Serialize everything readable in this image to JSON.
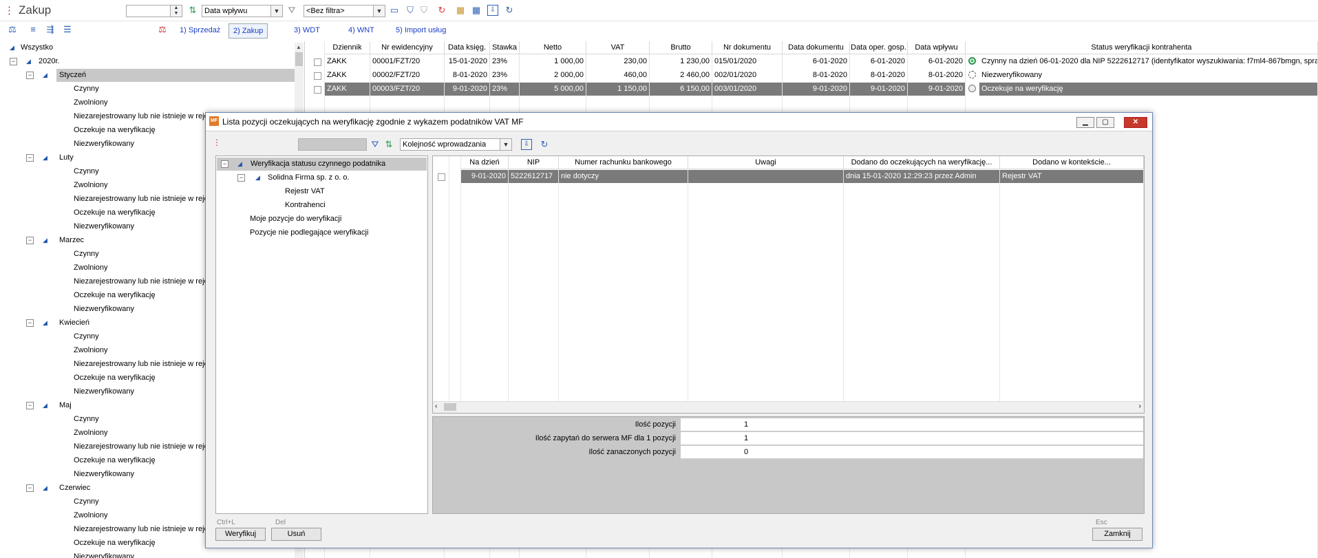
{
  "app": {
    "title": "Zakup"
  },
  "toolbar": {
    "sort_field": "Data wpływu",
    "filter": "<Bez filtra>"
  },
  "tabs": [
    {
      "label": "1) Sprzedaż"
    },
    {
      "label": "2) Zakup"
    },
    {
      "label": "3) WDT"
    },
    {
      "label": "4) WNT"
    },
    {
      "label": "5) Import usług"
    }
  ],
  "tree": {
    "root": "Wszystko",
    "year": "2020r.",
    "months": [
      {
        "name": "Styczeń",
        "children": [
          "Czynny",
          "Zwolniony",
          "Niezarejestrowany lub nie istnieje w rejes",
          "Oczekuje na weryfikację",
          "Niezweryfikowany"
        ]
      },
      {
        "name": "Luty",
        "children": [
          "Czynny",
          "Zwolniony",
          "Niezarejestrowany lub nie istnieje w rejes",
          "Oczekuje na weryfikację",
          "Niezweryfikowany"
        ]
      },
      {
        "name": "Marzec",
        "children": [
          "Czynny",
          "Zwolniony",
          "Niezarejestrowany lub nie istnieje w rejes",
          "Oczekuje na weryfikację",
          "Niezweryfikowany"
        ]
      },
      {
        "name": "Kwiecień",
        "children": [
          "Czynny",
          "Zwolniony",
          "Niezarejestrowany lub nie istnieje w rejes",
          "Oczekuje na weryfikację",
          "Niezweryfikowany"
        ]
      },
      {
        "name": "Maj",
        "children": [
          "Czynny",
          "Zwolniony",
          "Niezarejestrowany lub nie istnieje w rejes",
          "Oczekuje na weryfikację",
          "Niezweryfikowany"
        ]
      },
      {
        "name": "Czerwiec",
        "children": [
          "Czynny",
          "Zwolniony",
          "Niezarejestrowany lub nie istnieje w rejes",
          "Oczekuje na weryfikację",
          "Niezweryfikowany"
        ]
      }
    ]
  },
  "grid": {
    "headers": [
      "Dziennik",
      "Nr ewidencyjny",
      "Data księg.",
      "Stawka",
      "Netto",
      "VAT",
      "Brutto",
      "Nr dokumentu",
      "Data dokumentu",
      "Data oper. gosp.",
      "Data wpływu",
      "Status weryfikacji kontrahenta"
    ],
    "rows": [
      {
        "dziennik": "ZAKK",
        "nr": "00001/FZT/20",
        "data_ksieg": "15-01-2020",
        "stawka": "23%",
        "netto": "1 000,00",
        "vat": "230,00",
        "brutto": "1 230,00",
        "nr_dok": "015/01/2020",
        "data_dok": "6-01-2020",
        "data_oper": "6-01-2020",
        "data_wplywu": "6-01-2020",
        "status": "Czynny na dzień 06-01-2020 dla NIP 5222612717 (identyfikator wyszukiwania: f7ml4-867bmgn, spra",
        "status_icon": "active-circle-icon"
      },
      {
        "dziennik": "ZAKK",
        "nr": "00002/FZT/20",
        "data_ksieg": "8-01-2020",
        "stawka": "23%",
        "netto": "2 000,00",
        "vat": "460,00",
        "brutto": "2 460,00",
        "nr_dok": "002/01/2020",
        "data_dok": "8-01-2020",
        "data_oper": "8-01-2020",
        "data_wplywu": "8-01-2020",
        "status": "Niezweryfikowany",
        "status_icon": "dashed-circle-icon"
      },
      {
        "dziennik": "ZAKK",
        "nr": "00003/FZT/20",
        "data_ksieg": "9-01-2020",
        "stawka": "23%",
        "netto": "5 000,00",
        "vat": "1 150,00",
        "brutto": "6 150,00",
        "nr_dok": "003/01/2020",
        "data_dok": "9-01-2020",
        "data_oper": "9-01-2020",
        "data_wplywu": "9-01-2020",
        "status": "Oczekuje na weryfikację",
        "status_icon": "empty-circle-icon"
      }
    ]
  },
  "modal": {
    "title": "Lista pozycji oczekujących na weryfikację zgodnie z wykazem podatników VAT MF",
    "sort": "Kolejność wprowadzania",
    "tree": {
      "root": "Weryfikacja statusu czynnego podatnika",
      "company": "Solidna Firma sp. z o. o.",
      "company_children": [
        "Rejestr VAT",
        "Kontrahenci"
      ],
      "others": [
        "Moje pozycje do weryfikacji",
        "Pozycje nie podlegające weryfikacji"
      ]
    },
    "grid": {
      "headers": [
        "Na dzień",
        "NIP",
        "Numer rachunku bankowego",
        "Uwagi",
        "Dodano do oczekujących na weryfikację...",
        "Dodano w kontekście..."
      ],
      "row": {
        "na_dzien": "9-01-2020",
        "nip": "5222612717",
        "rachunek": "nie dotyczy",
        "uwagi": "",
        "dodano": "dnia 15-01-2020  12:29:23 przez Admin",
        "kontekst": "Rejestr VAT"
      }
    },
    "summary": [
      {
        "label": "Ilość pozycji",
        "value": "1"
      },
      {
        "label": "Ilość zapytań do serwera MF dla 1 pozycji",
        "value": "1"
      },
      {
        "label": "Ilość zanaczonych pozycji",
        "value": "0"
      }
    ],
    "buttons": {
      "verify_key": "Ctrl+L",
      "verify": "Weryfikuj",
      "delete_key": "Del",
      "delete": "Usuń",
      "close_key": "Esc",
      "close": "Zamknij"
    }
  },
  "colors": {
    "accent": "#1a3cc8",
    "selected_row": "#7a7a7a",
    "close_red": "#c7392b"
  }
}
